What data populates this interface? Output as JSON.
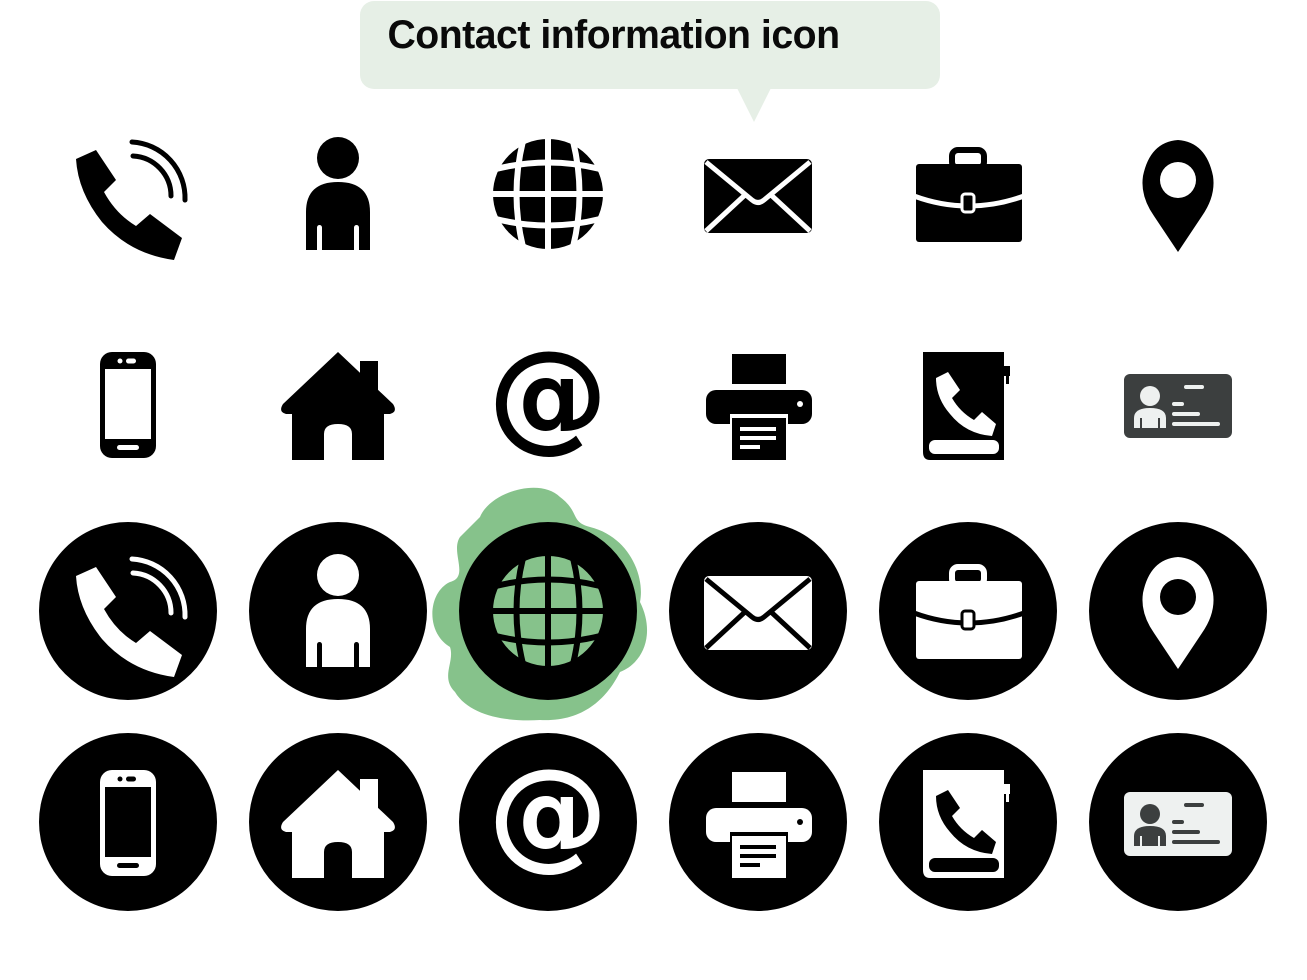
{
  "header": {
    "title": "Contact information icon",
    "bubble_color": "#e6efe6"
  },
  "colors": {
    "icon": "#000000",
    "inverse": "#ffffff",
    "accent_blob": "#86c28b",
    "id_card_dark": "#3c3f3f",
    "id_card_light": "#eef1f0"
  },
  "rows": [
    {
      "style": "plain",
      "icons": [
        "phone-call-icon",
        "user-icon",
        "globe-icon",
        "mail-icon",
        "briefcase-icon",
        "location-pin-icon"
      ]
    },
    {
      "style": "plain",
      "icons": [
        "smartphone-icon",
        "home-icon",
        "at-sign-icon",
        "printer-icon",
        "phone-book-icon",
        "id-card-icon"
      ]
    },
    {
      "style": "circle",
      "icons": [
        "phone-call-icon",
        "user-icon",
        "globe-icon",
        "mail-icon",
        "briefcase-icon",
        "location-pin-icon"
      ]
    },
    {
      "style": "circle",
      "icons": [
        "smartphone-icon",
        "home-icon",
        "at-sign-icon",
        "printer-icon",
        "phone-book-icon",
        "id-card-icon"
      ]
    }
  ],
  "highlighted_icon": "globe-icon"
}
